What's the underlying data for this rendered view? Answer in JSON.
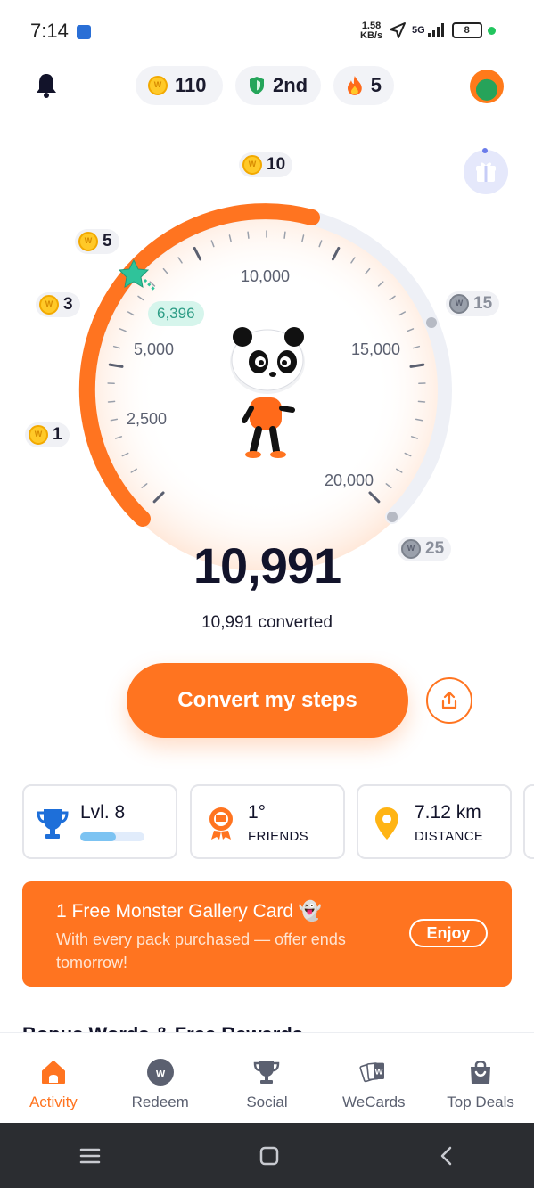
{
  "status_bar": {
    "time": "7:14",
    "speed_value": "1.58",
    "speed_unit": "KB/s",
    "network": "5G",
    "battery": "8"
  },
  "header": {
    "coins": "110",
    "rank": "2nd",
    "streak": "5"
  },
  "gauge": {
    "reward_markers": [
      "1",
      "3",
      "5",
      "10",
      "15",
      "25"
    ],
    "scale_labels": [
      "2,500",
      "5,000",
      "10,000",
      "15,000",
      "20,000"
    ],
    "progress_value": "6,396"
  },
  "steps": {
    "count": "10,991",
    "converted_text": "10,991 converted"
  },
  "actions": {
    "convert_label": "Convert my steps"
  },
  "stats": {
    "level": {
      "title": "Lvl. 8",
      "progress": 0.55
    },
    "friends": {
      "title": "1°",
      "sub": "FRIENDS"
    },
    "distance": {
      "title": "7.12 km",
      "sub": "DISTANCE"
    }
  },
  "banner": {
    "title": "1 Free Monster Gallery Card 👻",
    "text": "With every pack purchased — offer ends tomorrow!",
    "button": "Enjoy"
  },
  "next_section_title": "Bonus Words & Free Rewards",
  "nav": {
    "items": [
      {
        "label": "Activity",
        "icon": "home-icon"
      },
      {
        "label": "Redeem",
        "icon": "w-coin-icon"
      },
      {
        "label": "Social",
        "icon": "trophy-icon"
      },
      {
        "label": "WeCards",
        "icon": "cards-icon"
      },
      {
        "label": "Top Deals",
        "icon": "shopping-bag-icon"
      }
    ]
  },
  "colors": {
    "accent": "#ff7420",
    "track": "#eef0f6",
    "text_dark": "#12132a"
  }
}
